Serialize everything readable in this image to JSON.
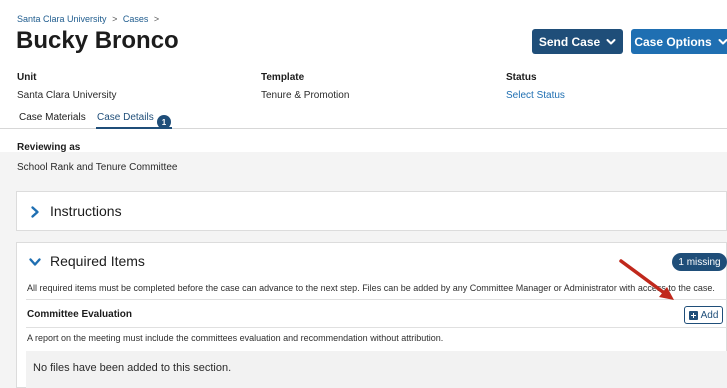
{
  "breadcrumb": {
    "items": [
      "Santa Clara University",
      "Cases"
    ],
    "separator": ">"
  },
  "header": {
    "title": "Bucky Bronco",
    "send_case_label": "Send Case",
    "case_options_label": "Case Options"
  },
  "meta": {
    "unit_label": "Unit",
    "unit_value": "Santa Clara University",
    "template_label": "Template",
    "template_value": "Tenure & Promotion",
    "status_label": "Status",
    "status_value": "Select Status"
  },
  "tabs": [
    {
      "label": "Case Materials",
      "active": false
    },
    {
      "label": "Case Details",
      "active": true,
      "badge": "1"
    }
  ],
  "reviewing": {
    "label": "Reviewing as",
    "value": "School Rank and Tenure Committee"
  },
  "instructions": {
    "title": "Instructions"
  },
  "required": {
    "title": "Required Items",
    "missing_badge": "1 missing",
    "description": "All required items must be completed before the case can advance to the next step. Files can be added by any Committee Manager or Administrator with access to the case.",
    "committee_evaluation": {
      "title": "Committee Evaluation",
      "add_label": "Add",
      "description": "A report on the meeting must include the committees evaluation and recommendation without attribution.",
      "empty_text": "No files have been added to this section."
    }
  },
  "colors": {
    "brand_dark": "#1f4e79",
    "brand_blue": "#1f6fb2",
    "annotation_arrow": "#c0281c"
  }
}
